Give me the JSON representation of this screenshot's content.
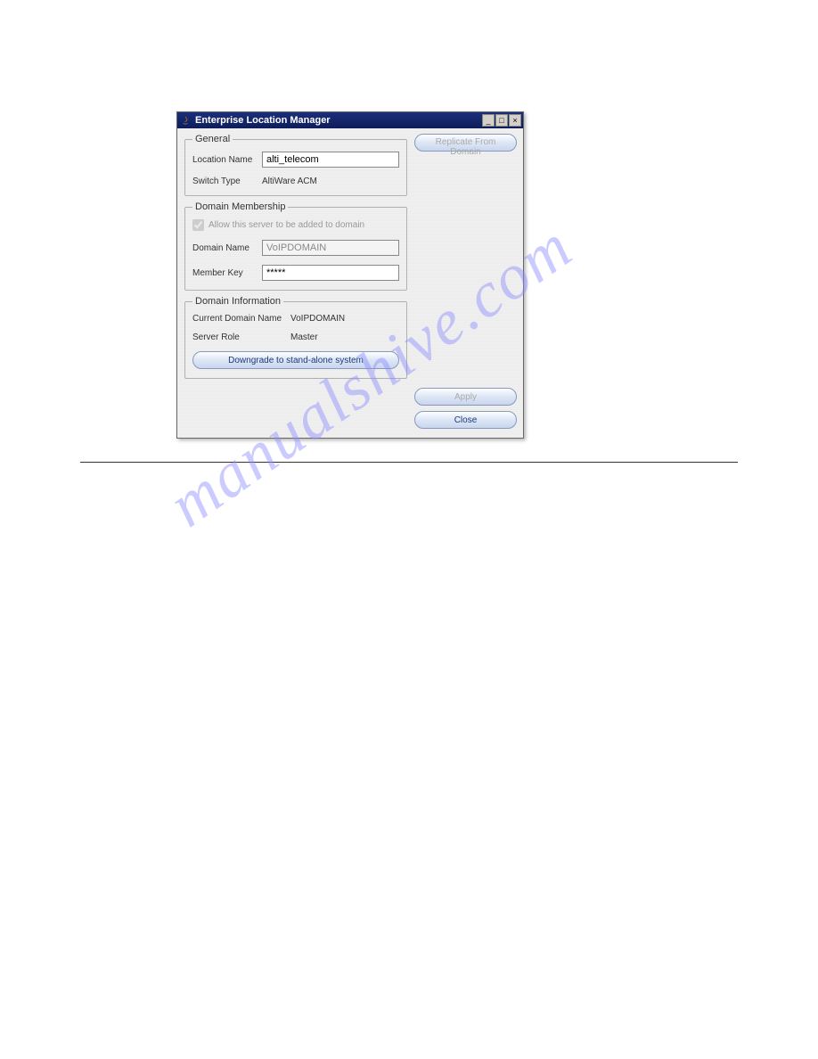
{
  "watermark": "manualshive.com",
  "titlebar": {
    "title": "Enterprise Location Manager"
  },
  "general": {
    "legend": "General",
    "location_name_label": "Location Name",
    "location_name_value": "alti_telecom",
    "switch_type_label": "Switch Type",
    "switch_type_value": "AltiWare ACM"
  },
  "membership": {
    "legend": "Domain Membership",
    "allow_label": "Allow this server to be added to domain",
    "domain_name_label": "Domain Name",
    "domain_name_value": "VoIPDOMAIN",
    "member_key_label": "Member Key",
    "member_key_value": "*****"
  },
  "domain_info": {
    "legend": "Domain Information",
    "current_domain_label": "Current Domain Name",
    "current_domain_value": "VoIPDOMAIN",
    "server_role_label": "Server Role",
    "server_role_value": "Master",
    "downgrade_label": "Downgrade to stand-alone system"
  },
  "buttons": {
    "replicate": "Replicate From Domain",
    "apply": "Apply",
    "close": "Close"
  }
}
